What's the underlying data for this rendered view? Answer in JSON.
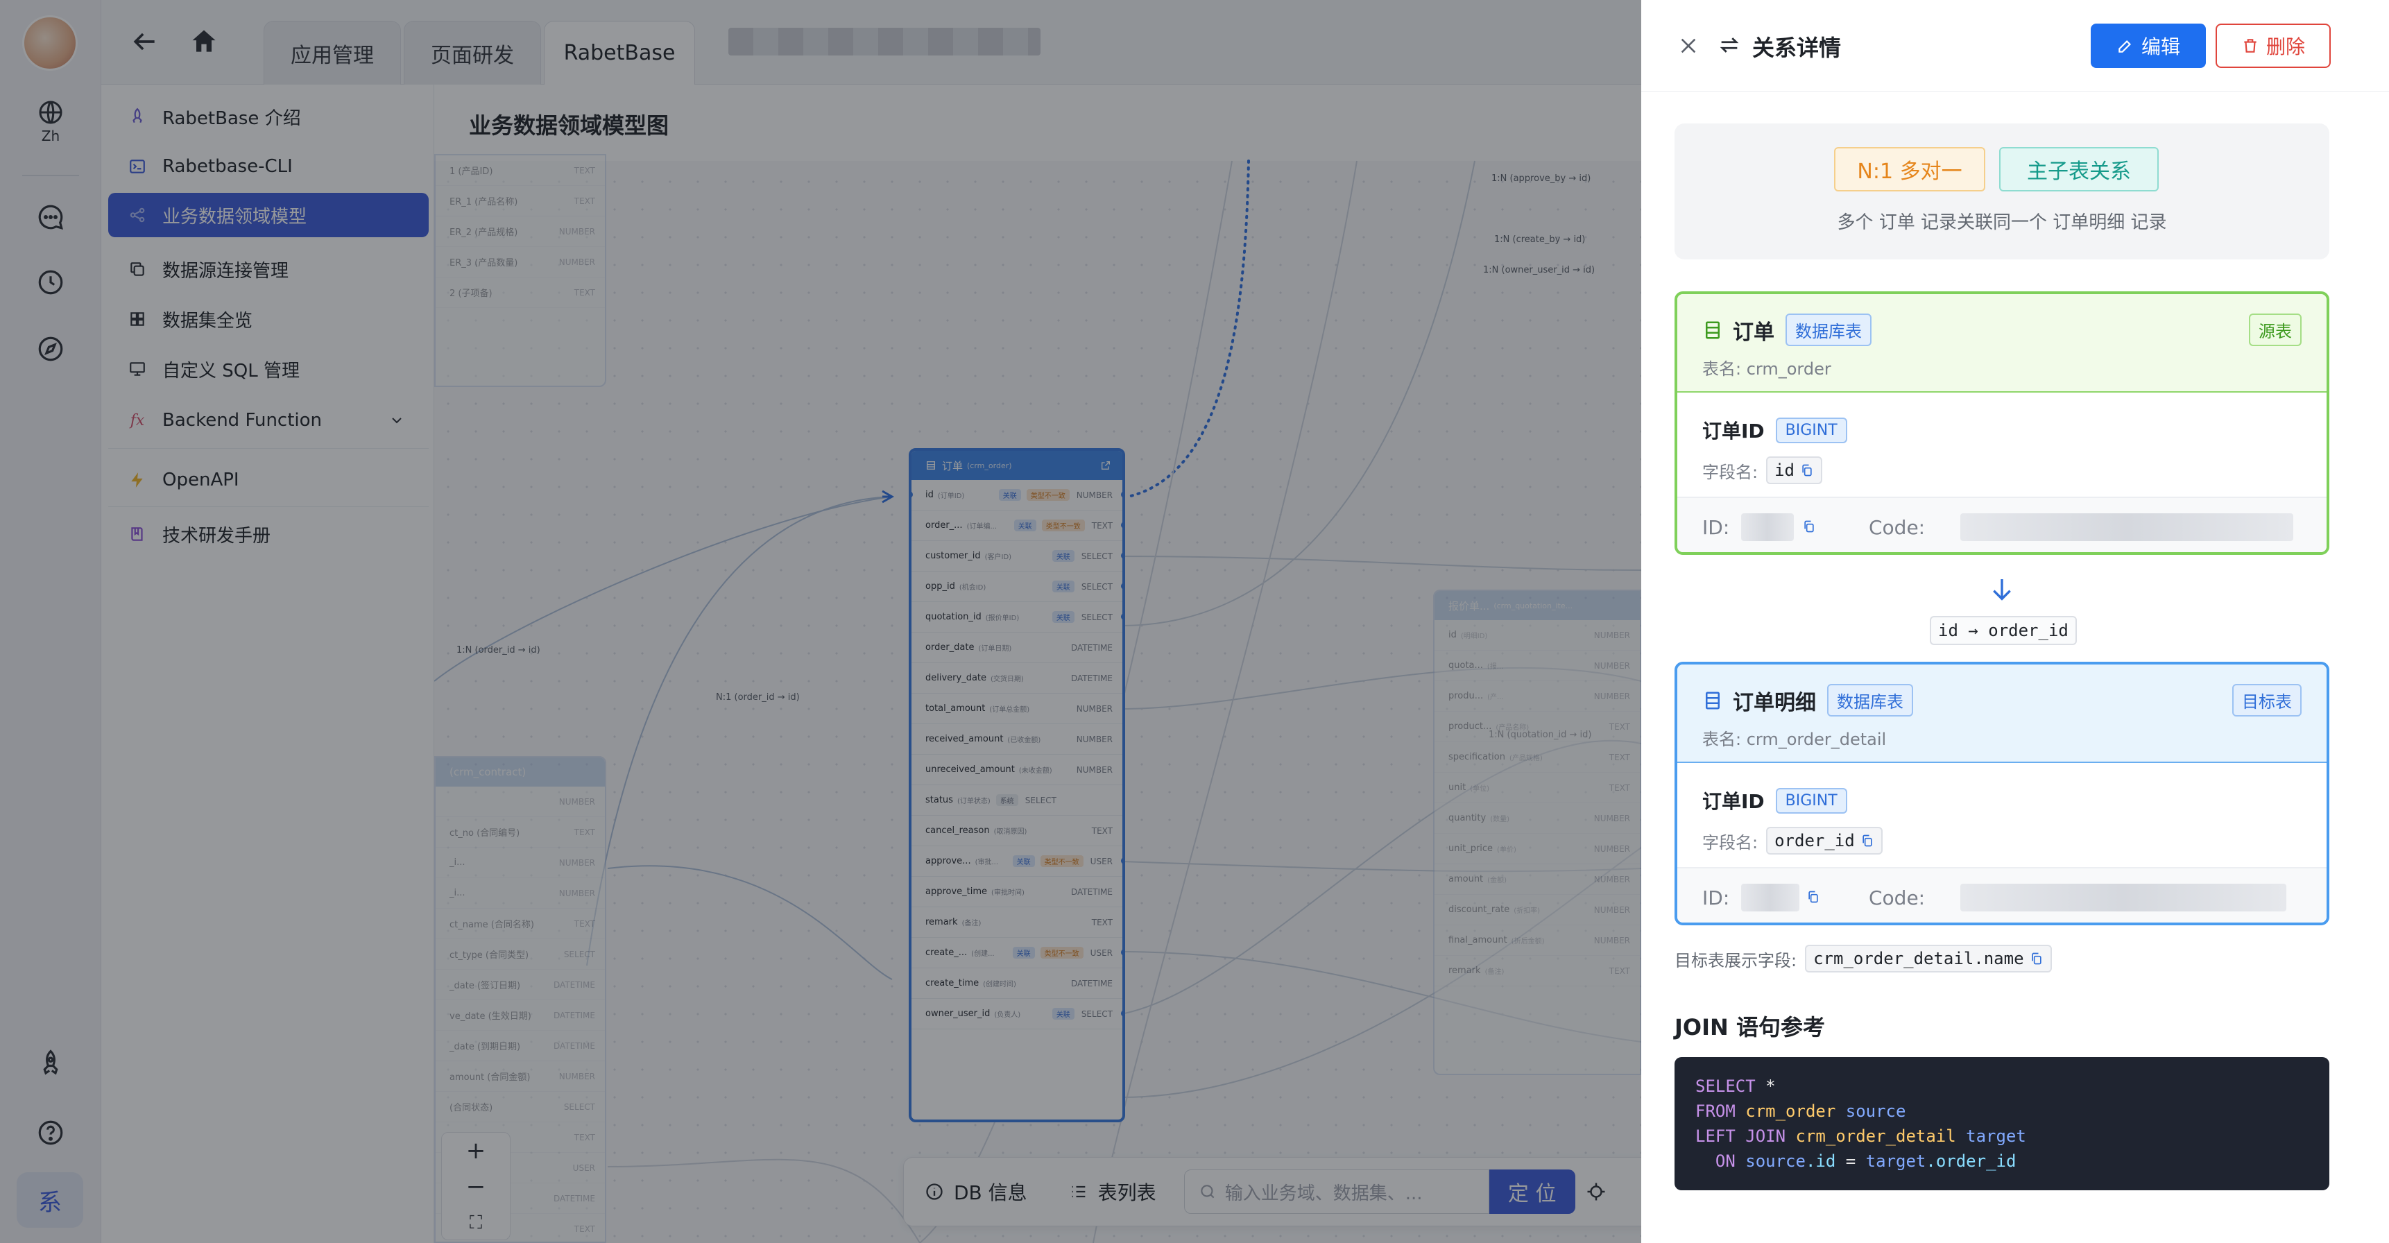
{
  "rail": {
    "lang_label": "Zh",
    "sys_label": "系"
  },
  "tabs": [
    {
      "label": "应用管理"
    },
    {
      "label": "页面研发"
    },
    {
      "label": "RabetBase"
    }
  ],
  "menu": {
    "items": [
      {
        "label": "RabetBase 介绍",
        "icon": "rocket-icon"
      },
      {
        "label": "Rabetbase-CLI",
        "icon": "terminal-icon"
      },
      {
        "label": "业务数据领域模型",
        "icon": "share-icon"
      },
      {
        "label": "数据源连接管理",
        "icon": "copy-icon"
      },
      {
        "label": "数据集全览",
        "icon": "grid-icon"
      },
      {
        "label": "自定义 SQL 管理",
        "icon": "monitor-icon"
      },
      {
        "label": "Backend Function",
        "icon": "fx-icon"
      },
      {
        "label": "OpenAPI",
        "icon": "bolt-icon"
      },
      {
        "label": "技术研发手册",
        "icon": "book-icon"
      }
    ],
    "fx_glyph": "fx"
  },
  "canvas": {
    "title": "业务数据领域模型图",
    "edge_labels": [
      "1:N (approve_by → id)",
      "1:N (create_by → id)",
      "1:N (owner_user_id → id)",
      "1:N (order_id → id)",
      "N:1 (order_id → id)",
      "1:N (quotation_id → id)"
    ],
    "order_table": {
      "title": "订单",
      "subtitle": "(crm_order)",
      "rows": [
        {
          "name": "id",
          "sub": "(订单ID)",
          "tags": [
            "关联",
            "类型不一致"
          ],
          "type": "NUMBER"
        },
        {
          "name": "order_...",
          "sub": "(订单编...",
          "tags": [
            "关联",
            "类型不一致"
          ],
          "type": "TEXT"
        },
        {
          "name": "customer_id",
          "sub": "(客户ID)",
          "tags": [
            "关联"
          ],
          "type": "SELECT"
        },
        {
          "name": "opp_id",
          "sub": "(机会ID)",
          "tags": [
            "关联"
          ],
          "type": "SELECT"
        },
        {
          "name": "quotation_id",
          "sub": "(报价单ID)",
          "tags": [
            "关联"
          ],
          "type": "SELECT"
        },
        {
          "name": "order_date",
          "sub": "(订单日期)",
          "tags": [],
          "type": "DATETIME"
        },
        {
          "name": "delivery_date",
          "sub": "(交货日期)",
          "tags": [],
          "type": "DATETIME"
        },
        {
          "name": "total_amount",
          "sub": "(订单总金额)",
          "tags": [],
          "type": "NUMBER"
        },
        {
          "name": "received_amount",
          "sub": "(已收金额)",
          "tags": [],
          "type": "NUMBER"
        },
        {
          "name": "unreceived_amount",
          "sub": "(未收金额)",
          "tags": [],
          "type": "NUMBER"
        },
        {
          "name": "status",
          "sub": "(订单状态)",
          "tags": [
            "系统"
          ],
          "type": "SELECT"
        },
        {
          "name": "cancel_reason",
          "sub": "(取消原因)",
          "tags": [],
          "type": "TEXT"
        },
        {
          "name": "approve...",
          "sub": "(审批...",
          "tags": [
            "关联",
            "类型不一致"
          ],
          "type": "USER"
        },
        {
          "name": "approve_time",
          "sub": "(审批时间)",
          "tags": [],
          "type": "DATETIME"
        },
        {
          "name": "remark",
          "sub": "(备注)",
          "tags": [],
          "type": "TEXT"
        },
        {
          "name": "create_...",
          "sub": "(创建...",
          "tags": [
            "关联",
            "类型不一致"
          ],
          "type": "USER"
        },
        {
          "name": "create_time",
          "sub": "(创建时间)",
          "tags": [],
          "type": "DATETIME"
        },
        {
          "name": "owner_user_id",
          "sub": "(负责人)",
          "tags": [
            "关联"
          ],
          "type": "SELECT"
        }
      ]
    },
    "right_table": {
      "title": "报价单...",
      "subtitle": "(crm_quotation_ite...",
      "rows": [
        {
          "name": "id",
          "sub": "(明细ID)",
          "type": "NUMBER"
        },
        {
          "name": "quota...",
          "sub": "(报...",
          "type": "NUMBER"
        },
        {
          "name": "produ...",
          "sub": "(产...",
          "type": "NUMBER"
        },
        {
          "name": "product...",
          "sub": "(产品名称)",
          "type": "TEXT"
        },
        {
          "name": "specification",
          "sub": "(产品规格)",
          "type": "TEXT"
        },
        {
          "name": "unit",
          "sub": "(单位)",
          "type": "TEXT"
        },
        {
          "name": "quantity",
          "sub": "(数量)",
          "type": "NUMBER"
        },
        {
          "name": "unit_price",
          "sub": "(单价)",
          "type": "NUMBER"
        },
        {
          "name": "amount",
          "sub": "(金额)",
          "type": "NUMBER"
        },
        {
          "name": "discount_rate",
          "sub": "(折扣率)",
          "type": "NUMBER"
        },
        {
          "name": "final_amount",
          "sub": "(折后金额)",
          "type": "NUMBER"
        },
        {
          "name": "remark",
          "sub": "(备注)",
          "type": "TEXT"
        }
      ]
    },
    "left_top_rows": [
      {
        "name": "1 (产品ID)",
        "type": "TEXT"
      },
      {
        "name": "ER_1 (产品名称)",
        "type": "TEXT"
      },
      {
        "name": "ER_2 (产品规格)",
        "type": "NUMBER"
      },
      {
        "name": "ER_3 (产品数量)",
        "type": "NUMBER"
      },
      {
        "name": "2 (子项备)",
        "type": "TEXT"
      }
    ],
    "left_bottom_table": {
      "title": "(crm_contract)",
      "rows": [
        {
          "name": "",
          "type": "NUMBER"
        },
        {
          "name": "ct_no (合同编号)",
          "type": "TEXT"
        },
        {
          "name": "_i...",
          "type": "NUMBER"
        },
        {
          "name": "_i...",
          "type": "NUMBER"
        },
        {
          "name": "ct_name (合同名称)",
          "type": "TEXT"
        },
        {
          "name": "ct_type (合同类型)",
          "type": "SELECT"
        },
        {
          "name": "_date (签订日期)",
          "type": "DATETIME"
        },
        {
          "name": "ve_date (生效日期)",
          "type": "DATETIME"
        },
        {
          "name": "_date (到期日期)",
          "type": "DATETIME"
        },
        {
          "name": "amount (合同金额)",
          "type": "NUMBER"
        },
        {
          "name": "(合同状态)",
          "type": "SELECT"
        },
        {
          "name": "ers...",
          "type": "TEXT"
        },
        {
          "name": "e...",
          "type": "USER"
        },
        {
          "name": "",
          "type": "DATETIME"
        },
        {
          "name": "",
          "type": "TEXT"
        }
      ]
    },
    "zoom": {
      "in": "+",
      "out": "−",
      "fit": "⛶"
    },
    "bottom_bar": {
      "db_info": "DB 信息",
      "table_list": "表列表",
      "search_placeholder": "输入业务域、数据集、...",
      "locate": "定 位"
    }
  },
  "drawer": {
    "title": "关系详情",
    "edit_label": "编辑",
    "delete_label": "删除",
    "relation_type": "N:1 多对一",
    "relation_kind": "主子表关系",
    "relation_desc": "多个 订单 记录关联同一个 订单明细 记录",
    "source": {
      "name": "订单",
      "badge": "数据库表",
      "flag": "源表",
      "table_label": "表名: crm_order",
      "field_name": "订单ID",
      "field_type": "BIGINT",
      "field_label": "字段名:",
      "field_code": "id",
      "id_label": "ID:",
      "code_label": "Code:"
    },
    "mapping": "id → order_id",
    "target": {
      "name": "订单明细",
      "badge": "数据库表",
      "flag": "目标表",
      "table_label": "表名: crm_order_detail",
      "field_name": "订单ID",
      "field_type": "BIGINT",
      "field_label": "字段名:",
      "field_code": "order_id",
      "id_label": "ID:",
      "code_label": "Code:"
    },
    "display_field_label": "目标表展示字段:",
    "display_field_value": "crm_order_detail.name",
    "join_title": "JOIN 语句参考",
    "sql": {
      "l1_kw": "SELECT",
      "l1_rest": " *",
      "l2_kw": "FROM",
      "l2_tb": " crm_order",
      "l2_al": " source",
      "l3_kw": "LEFT JOIN",
      "l3_tb": " crm_order_detail",
      "l3_al": " target",
      "l4_kw": "  ON",
      "l4_a": " source",
      "l4_b": ".id",
      "l4_eq": " = ",
      "l4_c": "target",
      "l4_d": ".order_id"
    }
  },
  "colors": {
    "accent": "#3d5bd9",
    "primary_button": "#1e6ff0",
    "danger": "#e0453c",
    "source_border": "#7fd05a",
    "target_border": "#4a9cef"
  }
}
